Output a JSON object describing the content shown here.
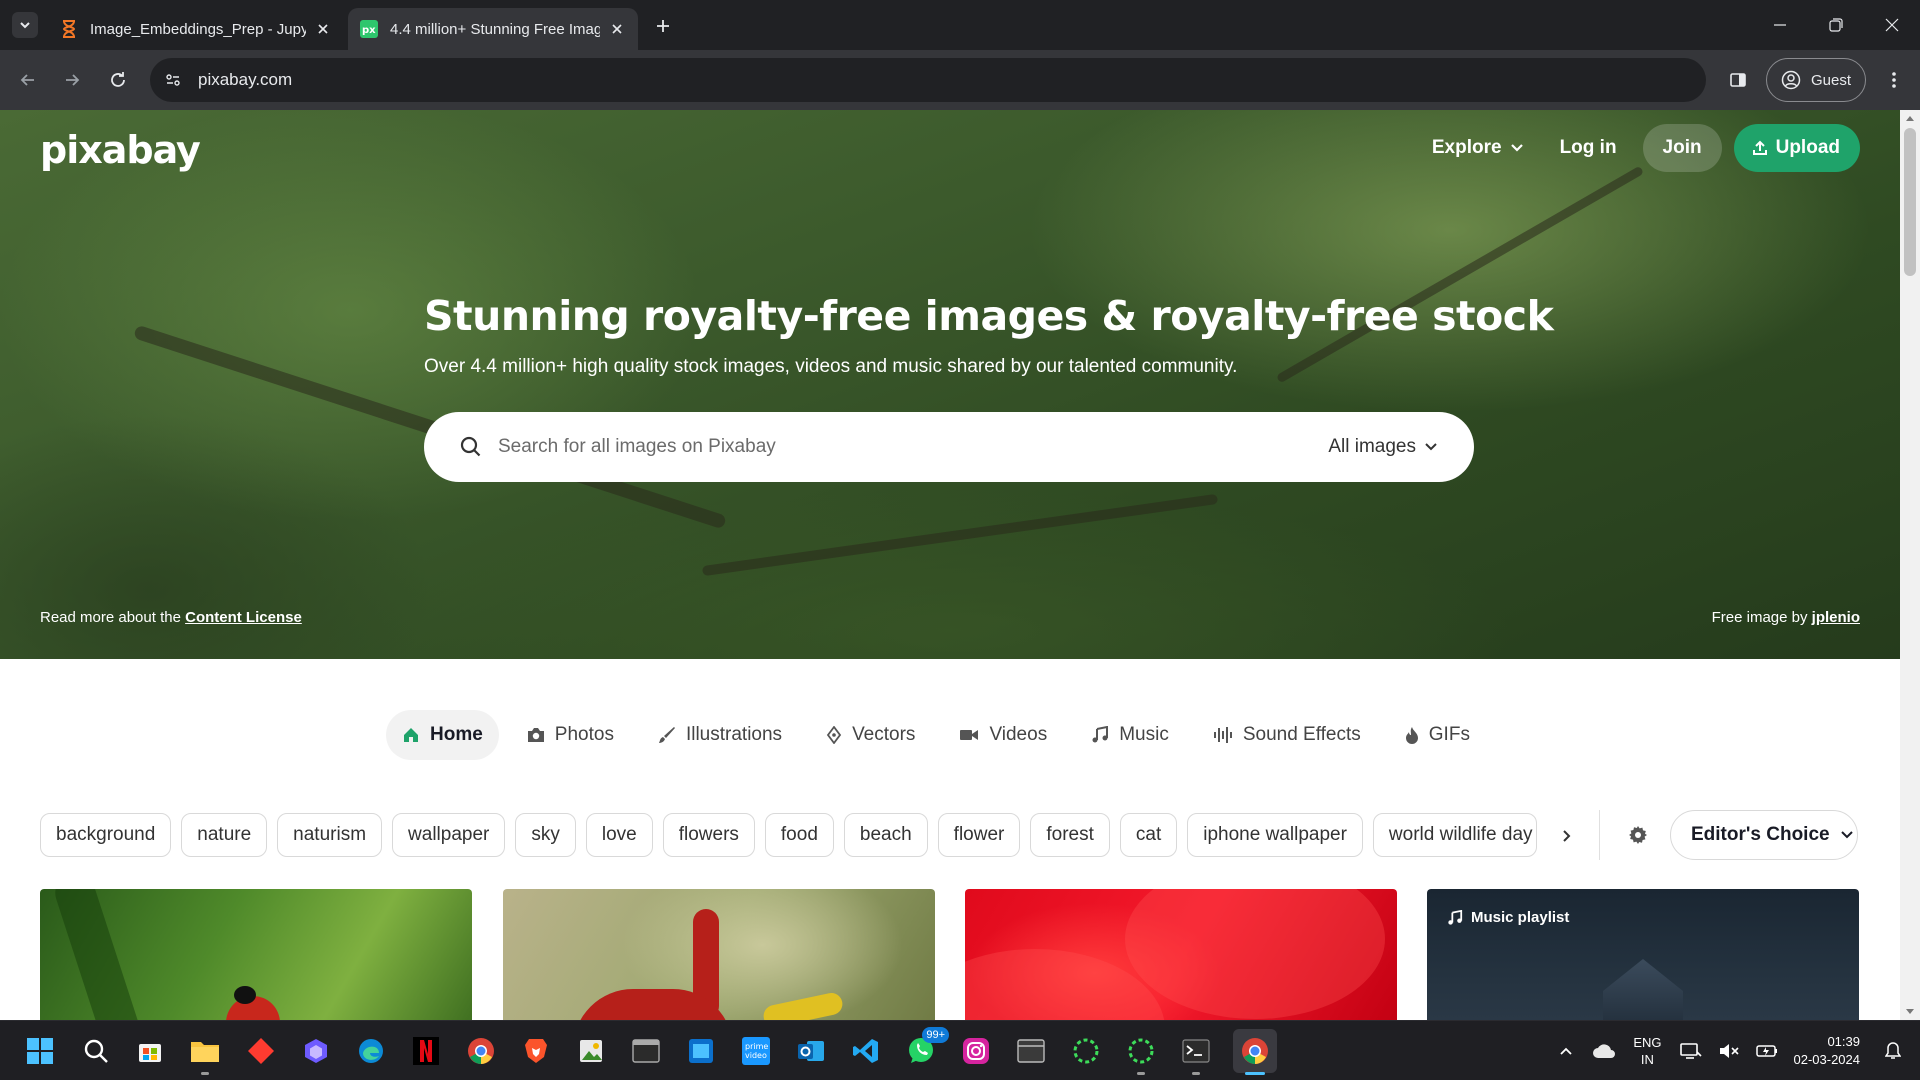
{
  "browser": {
    "tabs": [
      {
        "title": "Image_Embeddings_Prep - Jupy",
        "active": false
      },
      {
        "title": "4.4 million+ Stunning Free Imag",
        "active": true
      }
    ],
    "url": "pixabay.com",
    "profile_label": "Guest"
  },
  "site": {
    "logo": "pixabay",
    "nav": {
      "explore": "Explore",
      "login": "Log in",
      "join": "Join",
      "upload": "Upload"
    },
    "hero": {
      "title": "Stunning royalty-free images & royalty-free stock",
      "subtitle": "Over 4.4 million+ high quality stock images, videos and music shared by our talented community.",
      "search_placeholder": "Search for all images on Pixabay",
      "search_scope": "All images",
      "license_prefix": "Read more about the",
      "license_link": "Content License",
      "credit_prefix": "Free image by",
      "credit_author": "jplenio"
    },
    "categories": [
      {
        "label": "Home",
        "icon": "home-icon",
        "active": true
      },
      {
        "label": "Photos",
        "icon": "camera-icon",
        "active": false
      },
      {
        "label": "Illustrations",
        "icon": "brush-icon",
        "active": false
      },
      {
        "label": "Vectors",
        "icon": "pen-nib-icon",
        "active": false
      },
      {
        "label": "Videos",
        "icon": "video-camera-icon",
        "active": false
      },
      {
        "label": "Music",
        "icon": "music-note-icon",
        "active": false
      },
      {
        "label": "Sound Effects",
        "icon": "waveform-icon",
        "active": false
      },
      {
        "label": "GIFs",
        "icon": "flame-icon",
        "active": false
      }
    ],
    "tags": [
      "background",
      "nature",
      "naturism",
      "wallpaper",
      "sky",
      "love",
      "flowers",
      "food",
      "beach",
      "flower",
      "forest",
      "cat",
      "iphone wallpaper",
      "world wildlife day"
    ],
    "sort": "Editor's Choice",
    "gallery": {
      "music_badge": "Music playlist"
    }
  },
  "taskbar": {
    "whatsapp_badge": "99+",
    "lang_line1": "ENG",
    "lang_line2": "IN",
    "time": "01:39",
    "date": "02-03-2024"
  },
  "colors": {
    "accent_green": "#1fa36a",
    "chrome_dark": "#202124",
    "chrome_toolbar": "#35363a",
    "taskbar": "#1f1f23"
  }
}
